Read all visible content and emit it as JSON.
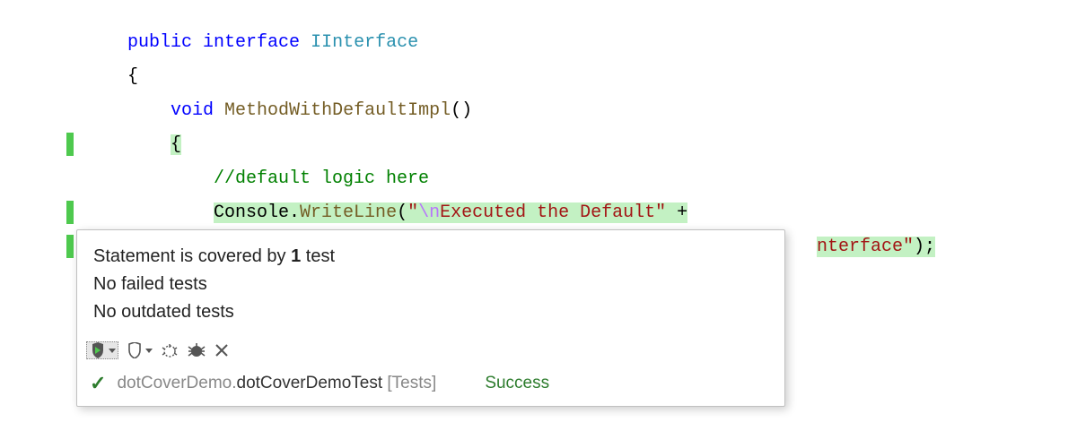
{
  "code": {
    "line1_public": "public",
    "line1_interface": "interface",
    "line1_name": "IInterface",
    "line2_brace": "{",
    "line3_void": "void",
    "line3_method": "MethodWithDefaultImpl",
    "line3_parens": "()",
    "line4_brace": "{",
    "line5_comment": "//default logic here",
    "line6_console": "Console",
    "line6_dot": ".",
    "line6_writeline": "WriteLine",
    "line6_paren_open": "(",
    "line6_quote1": "\"",
    "line6_escape": "\\n",
    "line6_str1": "Executed the Default\"",
    "line6_plus": " +",
    "line7_str2": "nterface\"",
    "line7_close": ");"
  },
  "popup": {
    "line1_pre": "Statement is covered by ",
    "line1_count": "1",
    "line1_post": " test",
    "line2": "No failed tests",
    "line3": "No outdated tests",
    "test_prefix": "dotCoverDemo.",
    "test_name": "dotCoverDemoTest",
    "test_suffix": " [Tests]",
    "status": "Success"
  }
}
